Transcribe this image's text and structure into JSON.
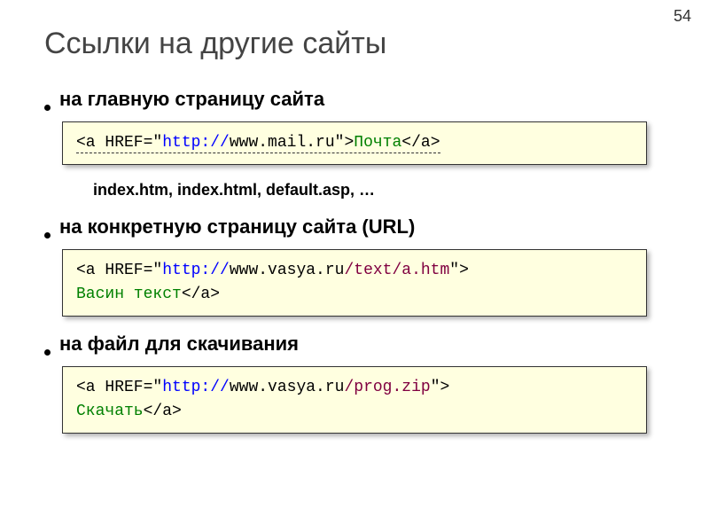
{
  "pageNumber": "54",
  "title": "Ссылки на другие сайты",
  "bullets": [
    {
      "text": "на главную страницу сайта"
    },
    {
      "text": "на конкретную страницу сайта (URL)"
    },
    {
      "text": "на файл для скачивания"
    }
  ],
  "note": "index.htm, index.html, default.asp, …",
  "code1": {
    "p1": "<a HREF=\"",
    "p2": "http://",
    "p3": "www.mail.ru",
    "p4": "\">",
    "p5": "Почта",
    "p6": "</a>"
  },
  "code2": {
    "p1": "<a HREF=\"",
    "p2": "http://",
    "p3": "www.vasya.ru",
    "p4": "/text/a.htm",
    "p5": "\">",
    "p6": "Васин текст",
    "p7": "</a>"
  },
  "code3": {
    "p1": "<a HREF=\"",
    "p2": "http://",
    "p3": "www.vasya.ru",
    "p4": "/prog.zip",
    "p5": "\">",
    "p6": "Скачать",
    "p7": "</a>"
  }
}
